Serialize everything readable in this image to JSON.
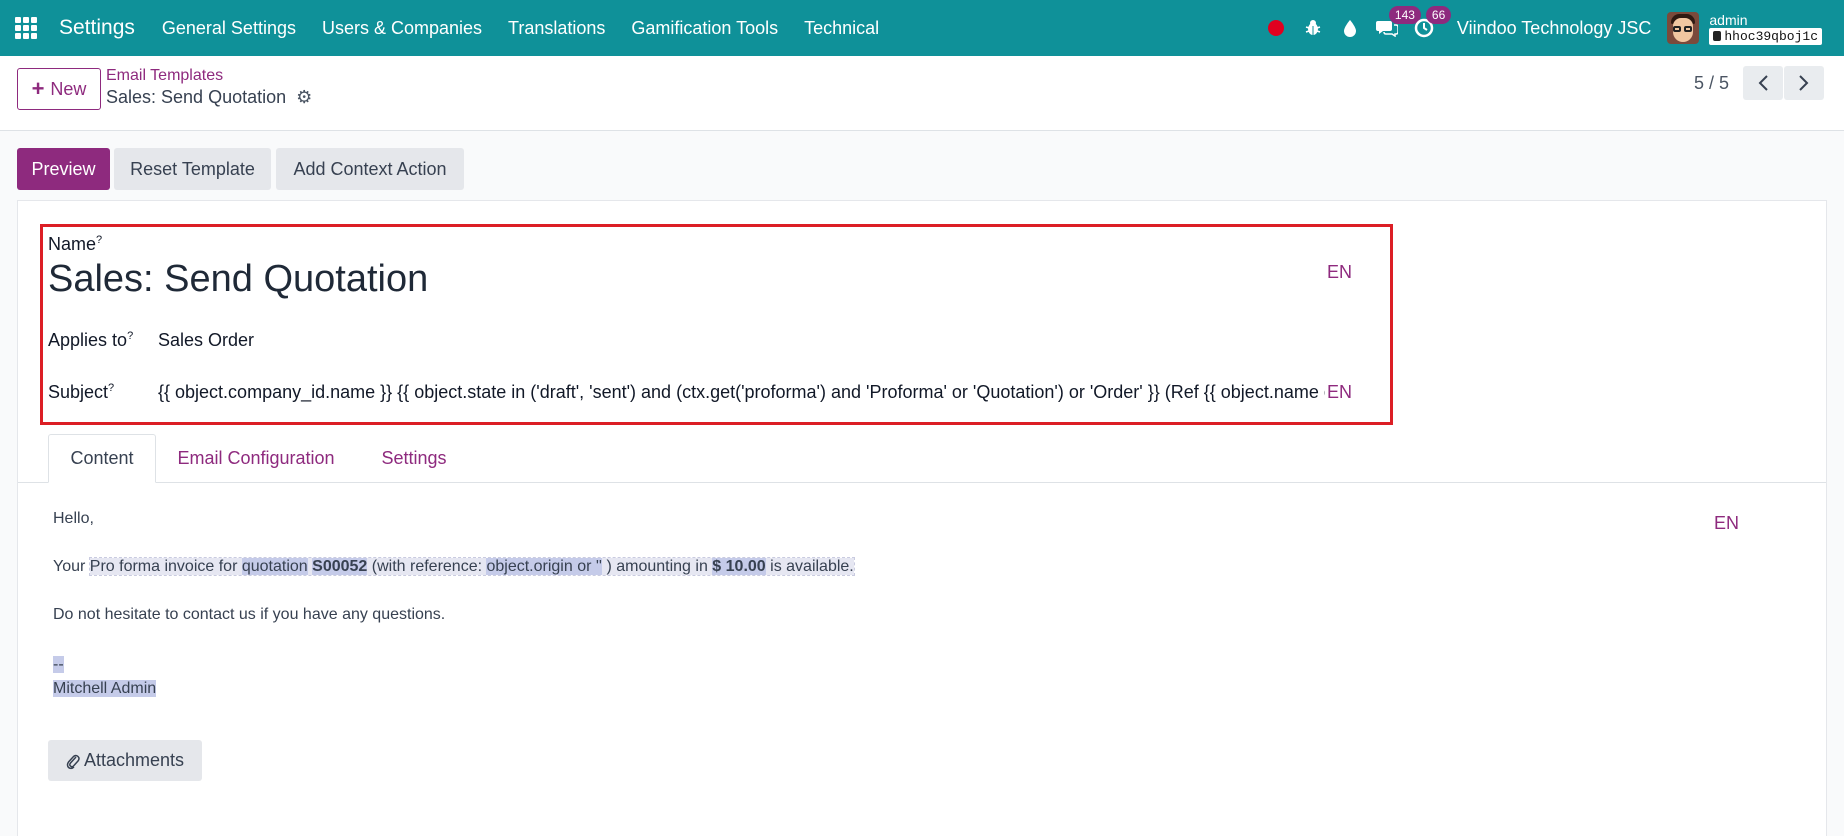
{
  "navbar": {
    "app_title": "Settings",
    "menu": [
      "General Settings",
      "Users & Companies",
      "Translations",
      "Gamification Tools",
      "Technical"
    ],
    "messages_badge": "143",
    "activities_badge": "66",
    "company": "Viindoo Technology JSC",
    "user": "admin",
    "database": "hhoc39qboj1c",
    "colors": {
      "bar": "#0f9199",
      "accent": "#8e2a7e",
      "record": "#e1001f"
    }
  },
  "control_panel": {
    "new_label": "New",
    "breadcrumb_parent": "Email Templates",
    "record_title": "Sales: Send Quotation",
    "pager": "5 / 5"
  },
  "actions": {
    "preview": "Preview",
    "reset": "Reset Template",
    "context": "Add Context Action"
  },
  "form": {
    "name_label": "Name",
    "name_value": "Sales: Send Quotation",
    "applies_label": "Applies to",
    "applies_value": "Sales Order",
    "subject_label": "Subject",
    "subject_value": "{{ object.company_id.name }} {{ object.state in ('draft', 'sent') and (ctx.get('proforma') and 'Proforma' or 'Quotation') or 'Order' }} (Ref {{ object.name or 'n/a' }})",
    "tooltip_mark": "?",
    "lang": "EN"
  },
  "tabs": [
    "Content",
    "Email Configuration",
    "Settings"
  ],
  "content": {
    "greeting": "Hello,",
    "line_prefix": "Your",
    "seg1": "Pro forma invoice for",
    "seg2": "quotation",
    "seg3": "S00052",
    "seg4": "(with reference:",
    "seg5": "object.origin or ''",
    "seg6": ")",
    "seg7": "amounting in",
    "seg8": "$ 10.00",
    "seg9": "is available.",
    "contact": "Do not hesitate to contact us if you have any questions.",
    "signature_sep": "--",
    "signature_name": "Mitchell Admin",
    "lang": "EN"
  },
  "attachments_label": "Attachments"
}
